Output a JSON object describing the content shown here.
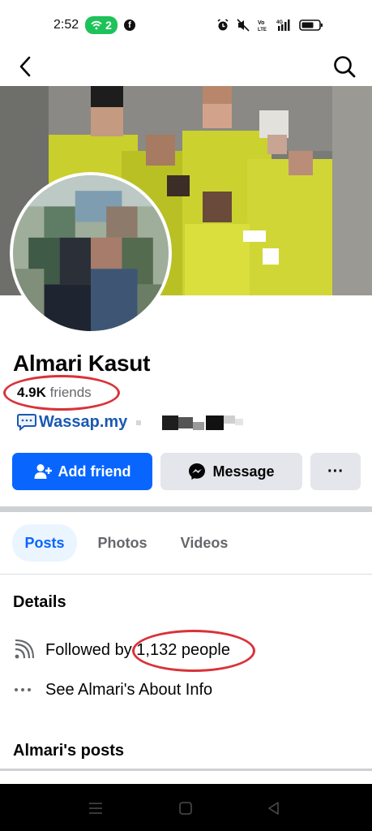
{
  "status_bar": {
    "time": "2:52",
    "wifi_count": "2",
    "facebook_glyph": "f",
    "volte_label": "Vo LTE",
    "network_label": "4G"
  },
  "profile": {
    "name": "Almari Kasut",
    "friends_count": "4.9K",
    "friends_label": "friends",
    "link_text": "Wassap.my"
  },
  "actions": {
    "add_friend": "Add friend",
    "message": "Message",
    "more": "···"
  },
  "tabs": [
    "Posts",
    "Photos",
    "Videos"
  ],
  "details": {
    "heading": "Details",
    "followed_prefix": "Followed by",
    "followed_count": "1,132 people",
    "about": "See Almari's About Info"
  },
  "posts_heading": "Almari's posts",
  "colors": {
    "primary": "#0866ff",
    "annotation_red": "#d9323a",
    "link_blue": "#1a59b3"
  },
  "icons": [
    "back-arrow-icon",
    "search-icon",
    "add-person-icon",
    "messenger-icon",
    "rss-icon",
    "more-dots-icon"
  ]
}
